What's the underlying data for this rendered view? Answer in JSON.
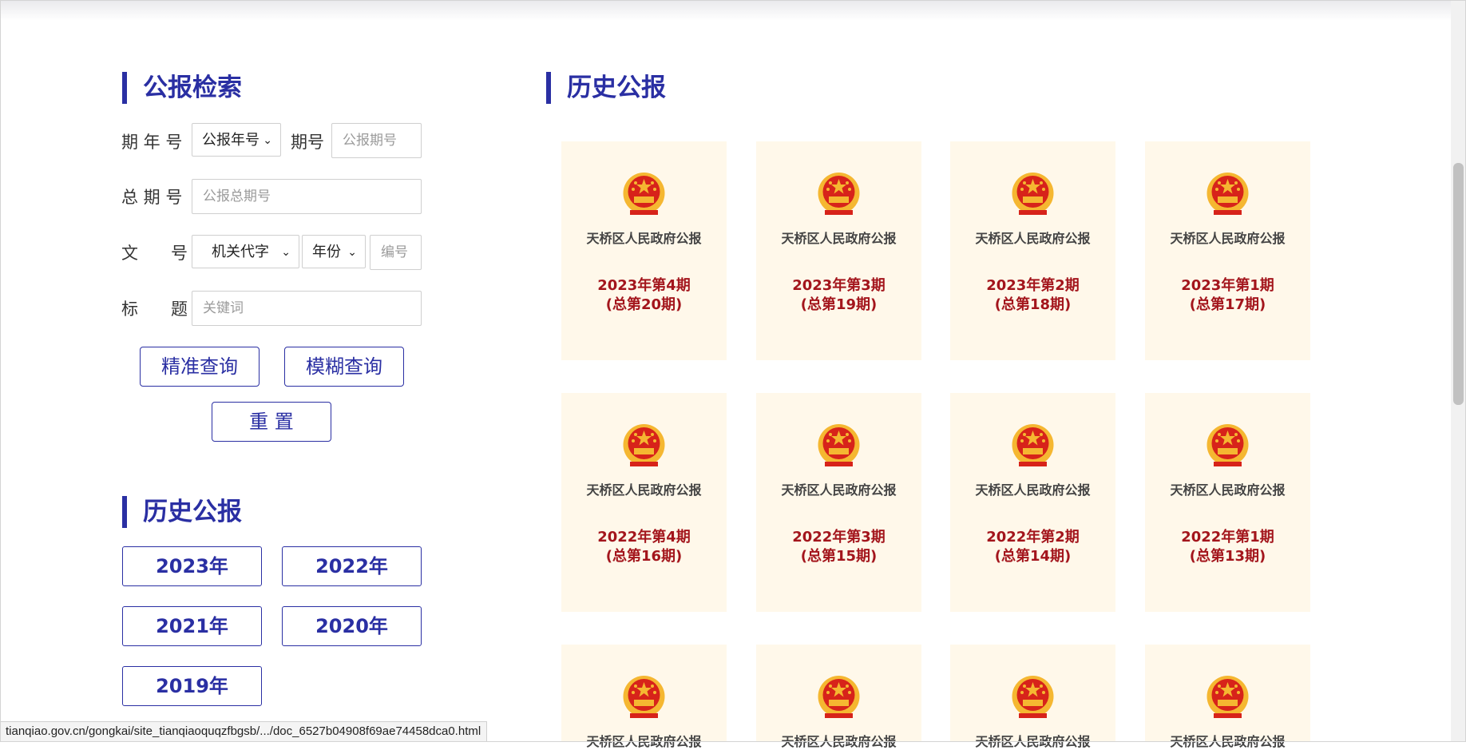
{
  "search": {
    "title": "公报检索",
    "period_label": "期 年 号",
    "year_select": "公报年号",
    "issue_label": "期号",
    "issue_placeholder": "公报期号",
    "total_label": "总 期 号",
    "total_placeholder": "公报总期号",
    "doc_label_1": "文",
    "doc_label_2": "号",
    "agency_select": "机关代字",
    "doc_year_select": "年份",
    "doc_no_placeholder": "编号",
    "subject_label_1": "标",
    "subject_label_2": "题",
    "keyword_placeholder": "关键词",
    "exact_button": "精准查询",
    "fuzzy_button": "模糊查询",
    "reset_button": "重 置"
  },
  "history_sidebar": {
    "title": "历史公报",
    "years": [
      "2023年",
      "2022年",
      "2021年",
      "2020年",
      "2019年"
    ]
  },
  "history_main": {
    "title": "历史公报",
    "cards": [
      {
        "name": "天桥区人民政府公报",
        "issue": "2023年第4期",
        "total": "(总第20期)"
      },
      {
        "name": "天桥区人民政府公报",
        "issue": "2023年第3期",
        "total": "(总第19期)"
      },
      {
        "name": "天桥区人民政府公报",
        "issue": "2023年第2期",
        "total": "(总第18期)"
      },
      {
        "name": "天桥区人民政府公报",
        "issue": "2023年第1期",
        "total": "(总第17期)"
      },
      {
        "name": "天桥区人民政府公报",
        "issue": "2022年第4期",
        "total": "(总第16期)"
      },
      {
        "name": "天桥区人民政府公报",
        "issue": "2022年第3期",
        "total": "(总第15期)"
      },
      {
        "name": "天桥区人民政府公报",
        "issue": "2022年第2期",
        "total": "(总第14期)"
      },
      {
        "name": "天桥区人民政府公报",
        "issue": "2022年第1期",
        "total": "(总第13期)"
      },
      {
        "name": "天桥区人民政府公报",
        "issue": "",
        "total": ""
      },
      {
        "name": "天桥区人民政府公报",
        "issue": "",
        "total": ""
      },
      {
        "name": "天桥区人民政府公报",
        "issue": "",
        "total": ""
      },
      {
        "name": "天桥区人民政府公报",
        "issue": "",
        "total": ""
      }
    ]
  },
  "status_bar": {
    "url": "tianqiao.gov.cn/gongkai/site_tianqiaoquqzfbgsb/.../doc_6527b04908f69ae74458dca0.html"
  },
  "icons": {
    "emblem": "national-emblem-icon",
    "select_chevron": "chevron-down-icon"
  },
  "colors": {
    "accent": "#2a2fa3",
    "card_background": "#fff8ea",
    "issue_text": "#a3151c",
    "emblem_red": "#d7231a",
    "emblem_gold": "#f5b731"
  }
}
